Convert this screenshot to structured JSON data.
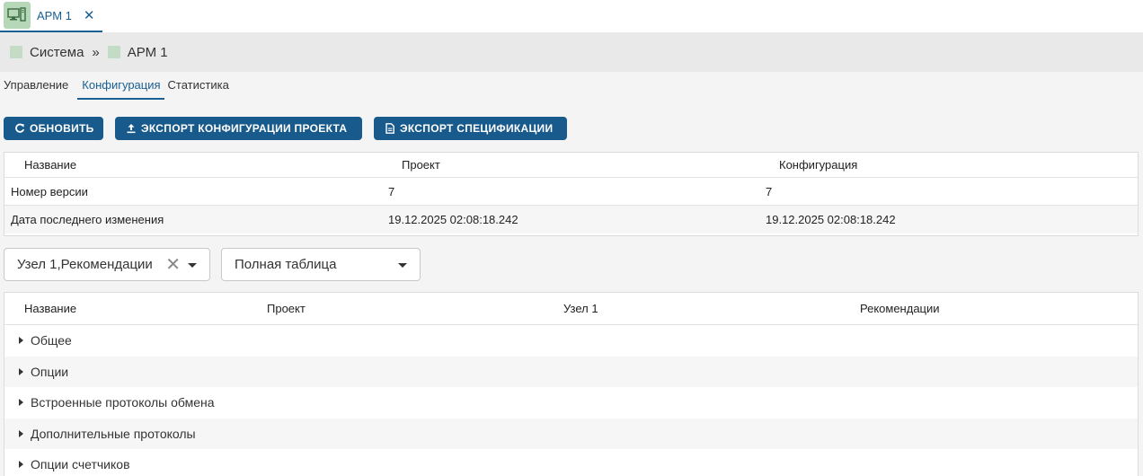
{
  "tab": {
    "label": "АРМ 1",
    "close": "✕",
    "icon": "workstation-icon"
  },
  "breadcrumb": {
    "items": [
      "Система",
      "АРМ 1"
    ],
    "separator": "»"
  },
  "subtabs": [
    "Управление",
    "Конфигурация",
    "Статистика"
  ],
  "active_subtab": "Конфигурация",
  "buttons": {
    "refresh": "ОБНОВИТЬ",
    "export_config": "ЭКСПОРТ КОНФИГУРАЦИИ ПРОЕКТА",
    "export_spec": "ЭКСПОРТ СПЕЦИФИКАЦИИ"
  },
  "version_table": {
    "headers": [
      "Название",
      "Проект",
      "Конфигурация"
    ],
    "rows": [
      [
        "Номер версии",
        "7",
        "7"
      ],
      [
        "Дата последнего изменения",
        "19.12.2025 02:08:18.242",
        "19.12.2025 02:08:18.242"
      ]
    ]
  },
  "filters": {
    "columns_value": "Узел 1,Рекомендации",
    "columns_clear": "✕",
    "view_value": "Полная таблица"
  },
  "tree_table": {
    "headers": [
      "Название",
      "Проект",
      "Узел 1",
      "Рекомендации"
    ],
    "rows": [
      "Общее",
      "Опции",
      "Встроенные протоколы обмена",
      "Дополнительные протоколы",
      "Опции счетчиков"
    ]
  },
  "colors": {
    "accent": "#195a8c",
    "tab_icon_bg": "#b7d7b9",
    "crumb_square": "#c4dcc5"
  }
}
